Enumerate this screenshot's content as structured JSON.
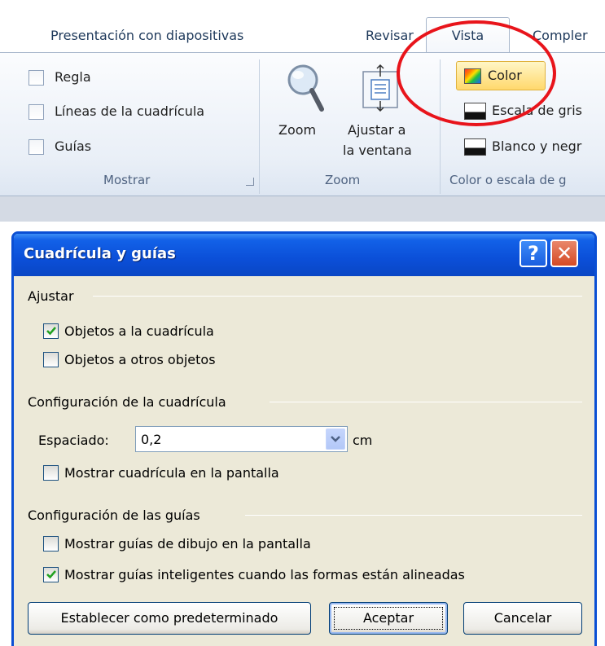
{
  "ribbon": {
    "tabs": [
      {
        "label": "Presentación con diapositivas"
      },
      {
        "label": "Revisar"
      },
      {
        "label": "Vista"
      },
      {
        "label": "Compler"
      }
    ],
    "show_group": {
      "items": [
        {
          "label": "Regla",
          "checked": false
        },
        {
          "label": "Líneas de la cuadrícula",
          "checked": false
        },
        {
          "label": "Guías",
          "checked": false
        }
      ],
      "label": "Mostrar"
    },
    "zoom_group": {
      "zoom_label": "Zoom",
      "fit_label_line1": "Ajustar a",
      "fit_label_line2": "la ventana",
      "label": "Zoom"
    },
    "color_group": {
      "color_label": "Color",
      "grayscale_label": "Escala de gris",
      "bw_label": "Blanco y negr",
      "label": "Color o escala de g"
    },
    "highlight_color": "#e8141b"
  },
  "dialog": {
    "title": "Cuadrícula y guías",
    "help_glyph": "?",
    "close_glyph": "✕",
    "snap_section": {
      "label": "Ajustar",
      "options": [
        {
          "label": "Objetos a la cuadrícula",
          "checked": true
        },
        {
          "label": "Objetos a otros objetos",
          "checked": false
        }
      ]
    },
    "grid_section": {
      "label": "Configuración de la cuadrícula",
      "spacing_label": "Espaciado:",
      "spacing_value": "0,2",
      "spacing_unit": "cm",
      "show_grid_label": "Mostrar cuadrícula en la pantalla",
      "show_grid_checked": false
    },
    "guides_section": {
      "label": "Configuración de las guías",
      "options": [
        {
          "label": "Mostrar guías de dibujo en la pantalla",
          "checked": false
        },
        {
          "label": "Mostrar guías inteligentes cuando las formas están alineadas",
          "checked": true
        }
      ]
    },
    "buttons": {
      "default": "Establecer como predeterminado",
      "accept": "Aceptar",
      "cancel": "Cancelar"
    }
  }
}
